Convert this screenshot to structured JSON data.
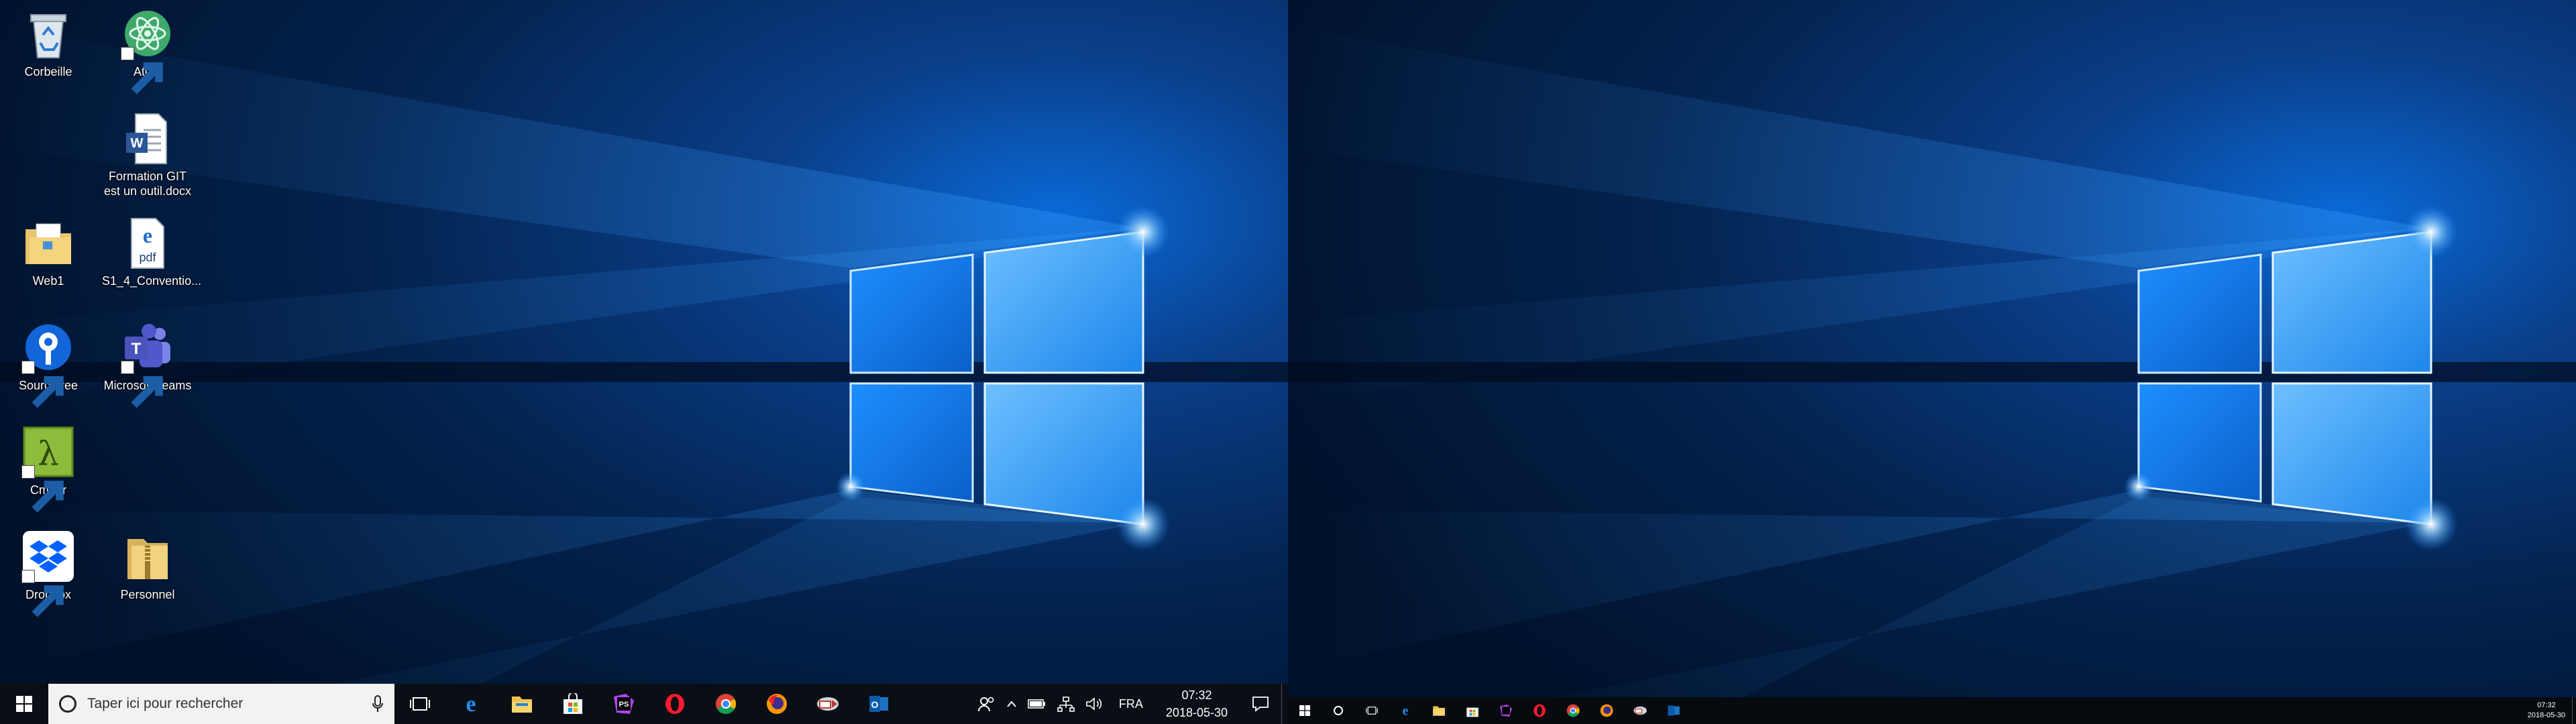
{
  "desktop": {
    "icons": [
      {
        "label": "Corbeille",
        "icon": "recycle-bin-icon"
      },
      {
        "label": "Atom",
        "icon": "atom-icon"
      },
      {
        "label": "Formation GIT est un outil.docx",
        "icon": "word-document-icon"
      },
      {
        "label": "Web1",
        "icon": "folder-icon"
      },
      {
        "label": "S1_4_Conventio...",
        "icon": "pdf-edge-icon"
      },
      {
        "label": "Sourcetree",
        "icon": "sourcetree-icon"
      },
      {
        "label": "Microsoft Teams",
        "icon": "teams-icon"
      },
      {
        "label": "Cmder",
        "icon": "cmder-icon"
      },
      {
        "label": "Dropbox",
        "icon": "dropbox-icon"
      },
      {
        "label": "Personnel",
        "icon": "folder-zip-icon"
      }
    ]
  },
  "taskbar_left": {
    "search_placeholder": "Taper ici pour rechercher",
    "apps": [
      "task-view-icon",
      "edge-icon",
      "file-explorer-icon",
      "store-icon",
      "phpstorm-icon",
      "opera-icon",
      "chrome-icon",
      "firefox-icon",
      "remote-app-icon",
      "outlook-icon"
    ],
    "tray": {
      "language": "FRA",
      "time": "07:32",
      "date": "2018-05-30"
    }
  },
  "taskbar_right": {
    "apps": [
      "cortana-icon",
      "task-view-icon",
      "edge-icon",
      "file-explorer-icon",
      "store-icon",
      "phpstorm-icon",
      "opera-icon",
      "chrome-icon",
      "firefox-icon",
      "remote-app-icon",
      "outlook-icon"
    ],
    "tray": {
      "time": "07:32",
      "date": "2018-05-30"
    }
  },
  "colors": {
    "wallpaper_dark": "#001433",
    "wallpaper_glow": "#1e8fff",
    "taskbar": "#0a0f16",
    "search_box": "#f2f2f2"
  }
}
